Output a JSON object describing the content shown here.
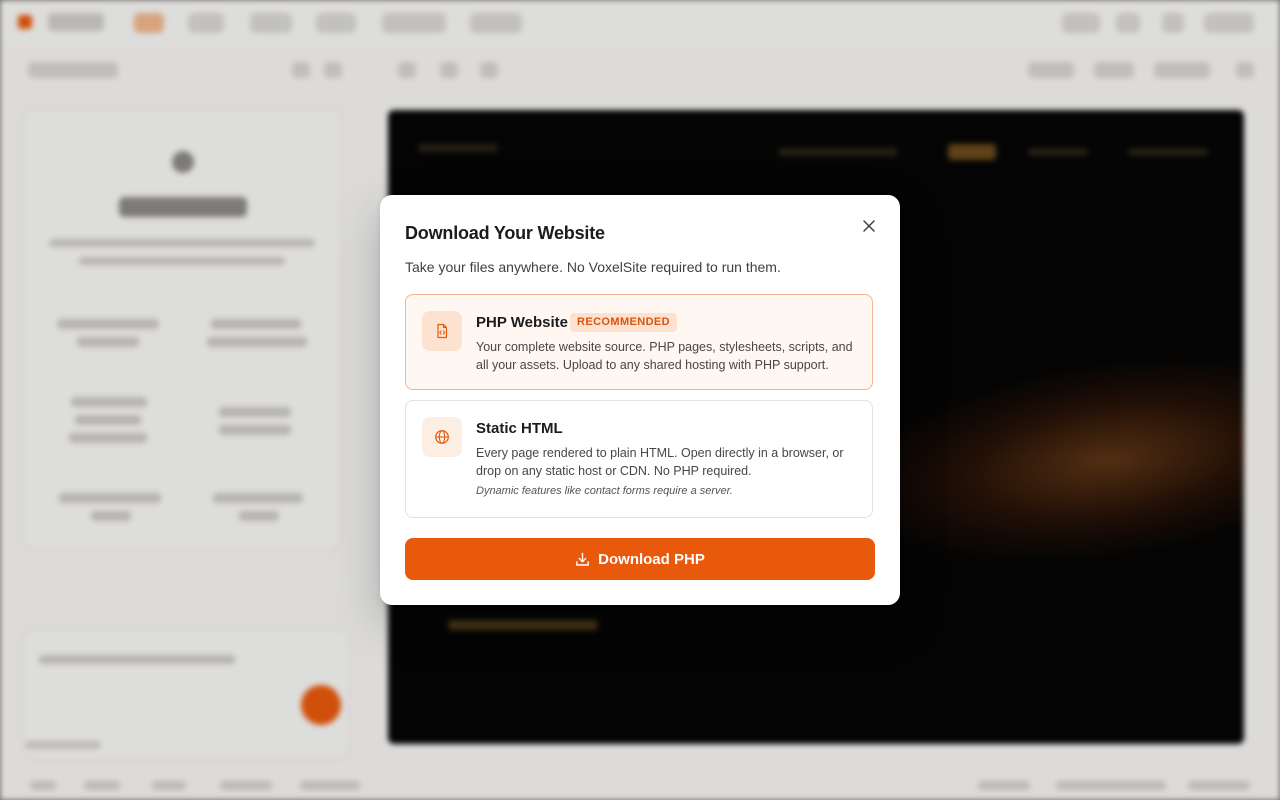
{
  "modal": {
    "title": "Download Your Website",
    "subtitle": "Take your files anywhere. No VoxelSite required to run them.",
    "close_icon": "close-icon",
    "options": [
      {
        "id": "php",
        "icon": "php-file-icon",
        "title": "PHP Website",
        "badge": "RECOMMENDED",
        "description": "Your complete website source. PHP pages, stylesheets, scripts, and all your assets. Upload to any shared hosting with PHP support.",
        "selected": true
      },
      {
        "id": "static",
        "icon": "globe-icon",
        "title": "Static HTML",
        "description": "Every page rendered to plain HTML. Open directly in a browser, or drop on any static host or CDN. No PHP required.",
        "note": "Dynamic features like contact forms require a server.",
        "selected": false
      }
    ],
    "download_button": {
      "icon": "download-icon",
      "label": "Download PHP"
    }
  },
  "colors": {
    "accent": "#e8590c",
    "selected_bg": "#fff7f2",
    "selected_border": "#f4b592",
    "badge_bg": "#fde1d1"
  }
}
